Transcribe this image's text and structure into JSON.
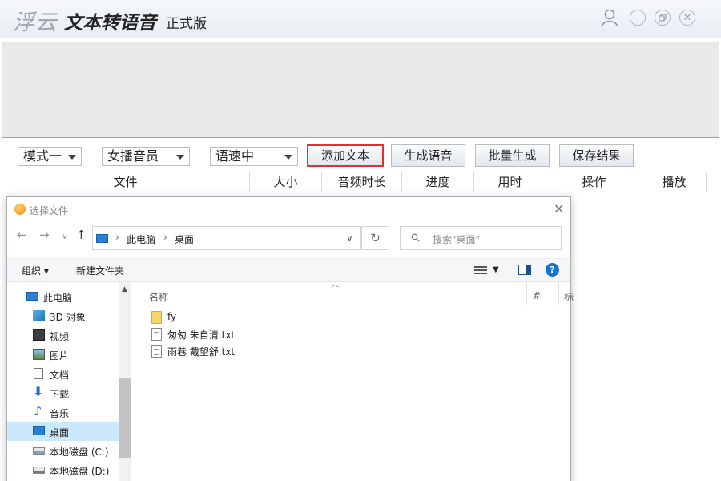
{
  "app": {
    "brand": "浮云",
    "title": "文本转语音",
    "edition": "正式版",
    "window_controls": [
      "user-icon",
      "minimize-icon",
      "restore-icon",
      "close-icon"
    ]
  },
  "toolbar": {
    "mode_select": "模式一",
    "voice_select": "女播音员",
    "speed_select": "语速中",
    "add_text": "添加文本",
    "generate": "生成语音",
    "batch": "批量生成",
    "save": "保存结果"
  },
  "grid": {
    "columns": [
      "文件",
      "大小",
      "音频时长",
      "进度",
      "用时",
      "操作",
      "播放"
    ]
  },
  "dialog": {
    "title": "选择文件",
    "close": "✕",
    "address": {
      "root": "此电脑",
      "current": "桌面"
    },
    "search_placeholder": "搜索\"桌面\"",
    "commands": {
      "organize": "组织",
      "new_folder": "新建文件夹"
    },
    "nav_tree": [
      {
        "label": "此电脑",
        "icon": "computer-icon"
      },
      {
        "label": "3D 对象",
        "icon": "cube-icon"
      },
      {
        "label": "视频",
        "icon": "video-icon"
      },
      {
        "label": "图片",
        "icon": "picture-icon"
      },
      {
        "label": "文档",
        "icon": "document-icon"
      },
      {
        "label": "下载",
        "icon": "download-icon"
      },
      {
        "label": "音乐",
        "icon": "music-icon"
      },
      {
        "label": "桌面",
        "icon": "desktop-icon",
        "selected": true
      },
      {
        "label": "本地磁盘 (C:)",
        "icon": "drive-icon"
      },
      {
        "label": "本地磁盘 (D:)",
        "icon": "drive-icon"
      }
    ],
    "file_headers": {
      "name": "名称",
      "number": "#",
      "title": "标"
    },
    "files": [
      {
        "name": "fy",
        "type": "folder"
      },
      {
        "name": "匆匆 朱自清.txt",
        "type": "txt"
      },
      {
        "name": "雨巷 戴望舒.txt",
        "type": "txt"
      }
    ]
  },
  "colors": {
    "accent_red": "#e0322d",
    "selection": "#cce8ff",
    "pc_blue": "#2d7fd3"
  }
}
